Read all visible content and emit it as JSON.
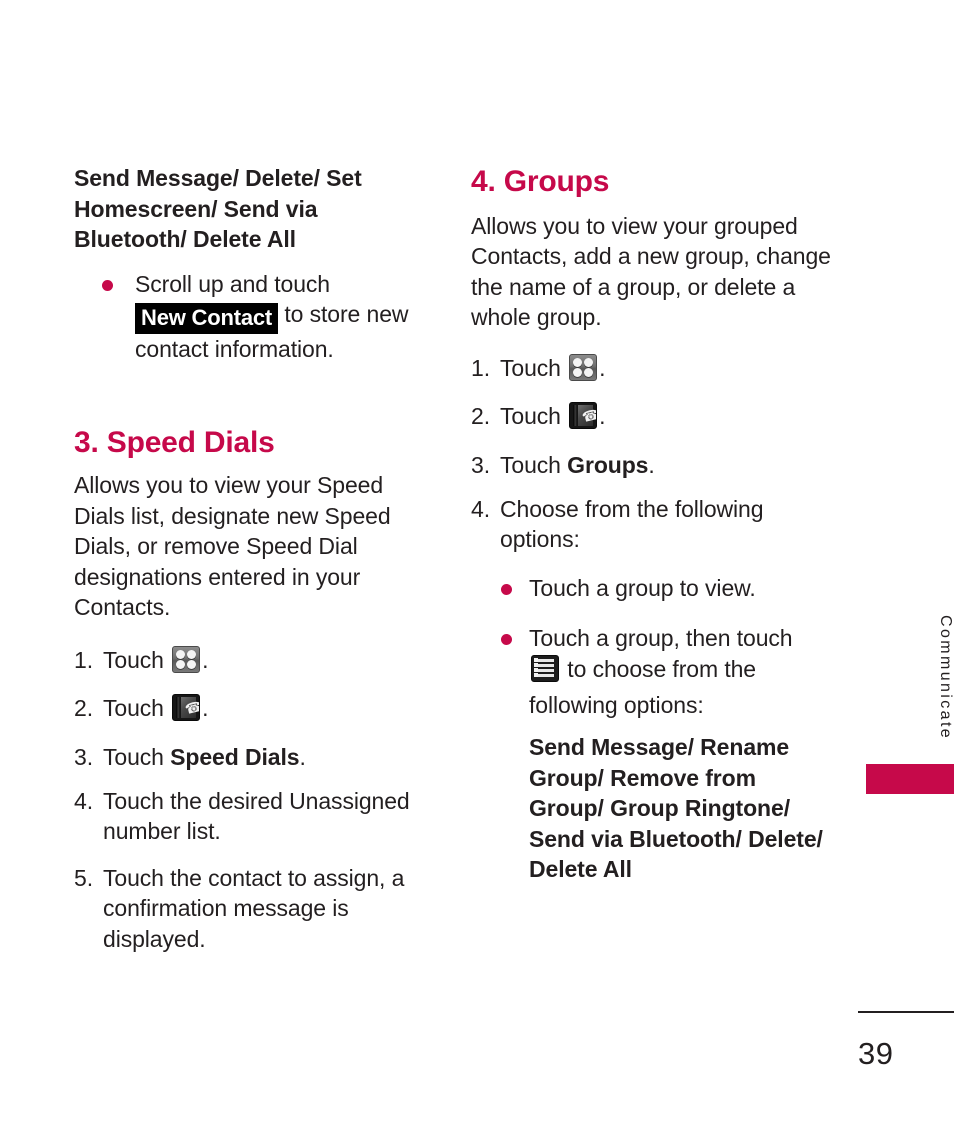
{
  "page": {
    "number": "39",
    "side_tab_label": "Communicate",
    "accent_color": "#c6094a",
    "text_color": "#231f20"
  },
  "left_column": {
    "carryover_options": "Send Message/ Delete/ Set Homescreen/ Send via Bluetooth/ Delete All",
    "carryover_bullet": {
      "before": "Scroll up and touch",
      "key_chip": "New Contact",
      "after": "to store new contact information."
    },
    "section": {
      "heading": "3. Speed Dials",
      "intro": "Allows you to view your Speed Dials list, designate new Speed Dials, or remove Speed Dial designations entered in your Contacts.",
      "steps": [
        {
          "num": "1.",
          "before": "Touch",
          "icon": "grid-menu-icon",
          "after": "."
        },
        {
          "num": "2.",
          "before": "Touch",
          "icon": "contacts-book-icon",
          "after": "."
        },
        {
          "num": "3.",
          "before": "Touch",
          "bold": "Speed Dials",
          "after": "."
        },
        {
          "num": "4.",
          "text": "Touch the desired Unassigned number list."
        },
        {
          "num": "5.",
          "text": "Touch the contact to assign, a confirmation message is displayed."
        }
      ]
    }
  },
  "right_column": {
    "section": {
      "heading": "4. Groups",
      "intro": "Allows you to view your grouped Contacts, add a new group, change the name of a group, or delete a whole group.",
      "steps": [
        {
          "num": "1.",
          "before": "Touch",
          "icon": "grid-menu-icon",
          "after": "."
        },
        {
          "num": "2.",
          "before": "Touch",
          "icon": "contacts-book-icon",
          "after": "."
        },
        {
          "num": "3.",
          "before": "Touch",
          "bold": "Groups",
          "after": "."
        },
        {
          "num": "4.",
          "text": "Choose from the following options:"
        }
      ],
      "bullets": [
        {
          "text": "Touch a group to view."
        },
        {
          "before": "Touch a group, then touch",
          "icon": "options-list-icon",
          "after": "to choose from the following options:",
          "options": "Send Message/ Rename Group/ Remove from Group/ Group Ringtone/ Send via Bluetooth/ Delete/ Delete All"
        }
      ]
    }
  }
}
